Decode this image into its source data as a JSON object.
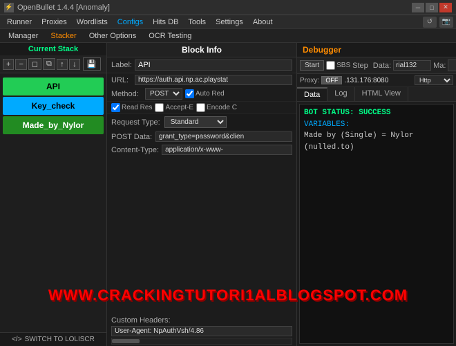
{
  "titlebar": {
    "title": "OpenBullet 1.4.4 [Anomaly]",
    "icon": "⚡",
    "minimize": "─",
    "maximize": "□",
    "close": "✕"
  },
  "menubar": {
    "items": [
      {
        "label": "Runner",
        "active": false
      },
      {
        "label": "Proxies",
        "active": false
      },
      {
        "label": "Wordlists",
        "active": false
      },
      {
        "label": "Configs",
        "active": true
      },
      {
        "label": "Hits DB",
        "active": false
      },
      {
        "label": "Tools",
        "active": false
      },
      {
        "label": "Settings",
        "active": false
      },
      {
        "label": "About",
        "active": false
      }
    ],
    "icon1": "↺",
    "icon2": "📷"
  },
  "submenu": {
    "items": [
      {
        "label": "Manager",
        "active": false
      },
      {
        "label": "Stacker",
        "active": true
      },
      {
        "label": "Other Options",
        "active": false
      },
      {
        "label": "OCR Testing",
        "active": false
      }
    ]
  },
  "left_panel": {
    "current_stack_label": "Current Stack",
    "tools": [
      "+",
      "−",
      "◻",
      "⧉",
      "↑",
      "↓"
    ],
    "save_icon": "💾",
    "items": [
      {
        "label": "API",
        "type": "api"
      },
      {
        "label": "Key_check",
        "type": "key"
      },
      {
        "label": "Made_by_Nylor",
        "type": "made"
      }
    ],
    "switch_btn": "SWITCH TO LOLISCR"
  },
  "center_panel": {
    "block_info_label": "Block Info",
    "label_label": "Label:",
    "label_value": "API",
    "url_label": "URL:",
    "url_value": "https://auth.api.np.ac.playstat",
    "method_label": "Method:",
    "method_value": "POST",
    "auto_redirect": "Auto Red",
    "read_response": "Read Res",
    "accept_encoding": "Accept-E",
    "encode_content": "Encode C",
    "request_type_label": "Request Type:",
    "request_type_value": "Standard",
    "post_data_label": "POST Data:",
    "post_data_value": "grant_type=password&clien",
    "content_type_label": "Content-Type:",
    "content_type_value": "application/x-www-",
    "custom_headers_label": "Custom Headers:",
    "custom_headers_value": "User-Agent: NpAuthVsh/4.86"
  },
  "right_panel": {
    "debugger_label": "Debugger",
    "start_btn": "Start",
    "sbs_label": "SBS",
    "step_label": "Step",
    "data_label": "Data:",
    "data_value": "rial132",
    "ma_label": "Ma:",
    "proxy_label": "Proxy:",
    "proxy_off": "OFF",
    "proxy_addr": ".131.176:8080",
    "proxy_type": "Http",
    "tabs": [
      "Data",
      "Log",
      "HTML View"
    ],
    "active_tab": 0,
    "output": {
      "line1": "BOT STATUS: SUCCESS",
      "line2": "VARIABLES:",
      "line3": "Made by (Single) = Nylor",
      "line4": "(nulled.to)"
    }
  },
  "watermark": {
    "text": "WWW.CRACKINGTUTORI AL BLOGSPOT.COM",
    "display": "WWW.CRACKINGTUTORI1ALBLOGSPOT.COM"
  }
}
